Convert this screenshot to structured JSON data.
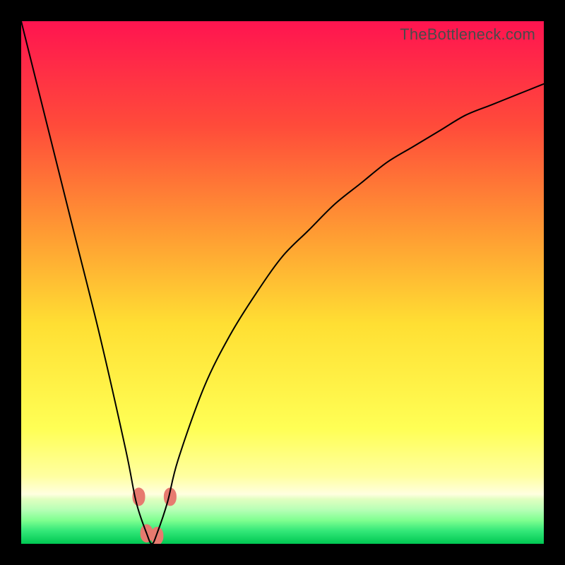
{
  "watermark": "TheBottleneck.com",
  "chart_data": {
    "type": "line",
    "title": "",
    "xlabel": "",
    "ylabel": "",
    "xlim": [
      0,
      100
    ],
    "ylim": [
      0,
      100
    ],
    "grid": false,
    "legend": false,
    "annotations": [],
    "curve": {
      "description": "V-shaped bottleneck curve with minimum near x≈25; left branch steep, right branch shallower; minimum touches y≈0",
      "x": [
        0,
        5,
        10,
        15,
        20,
        22,
        24,
        25,
        26,
        28,
        30,
        35,
        40,
        45,
        50,
        55,
        60,
        65,
        70,
        75,
        80,
        85,
        90,
        95,
        100
      ],
      "y": [
        100,
        80,
        60,
        40,
        18,
        8,
        2,
        0,
        2,
        8,
        16,
        30,
        40,
        48,
        55,
        60,
        65,
        69,
        73,
        76,
        79,
        82,
        84,
        86,
        88
      ]
    },
    "markers": {
      "description": "Salmon rounded markers clustered at the trough between x≈22 and x≈29 at low y",
      "points": [
        {
          "x": 22.5,
          "y": 9
        },
        {
          "x": 24.0,
          "y": 2
        },
        {
          "x": 26.0,
          "y": 1.5
        },
        {
          "x": 28.5,
          "y": 9
        }
      ],
      "color": "#e77a6f"
    },
    "background_gradient": {
      "stops": [
        {
          "pos": 0.0,
          "color": "#ff1450"
        },
        {
          "pos": 0.2,
          "color": "#ff4b3a"
        },
        {
          "pos": 0.4,
          "color": "#ff9933"
        },
        {
          "pos": 0.58,
          "color": "#ffdf33"
        },
        {
          "pos": 0.78,
          "color": "#ffff55"
        },
        {
          "pos": 0.87,
          "color": "#ffffa0"
        },
        {
          "pos": 0.905,
          "color": "#ffffe0"
        },
        {
          "pos": 0.915,
          "color": "#e0ffc0"
        },
        {
          "pos": 0.935,
          "color": "#b6ffb6"
        },
        {
          "pos": 0.955,
          "color": "#7fff90"
        },
        {
          "pos": 0.975,
          "color": "#34e879"
        },
        {
          "pos": 1.0,
          "color": "#00c853"
        }
      ]
    }
  }
}
